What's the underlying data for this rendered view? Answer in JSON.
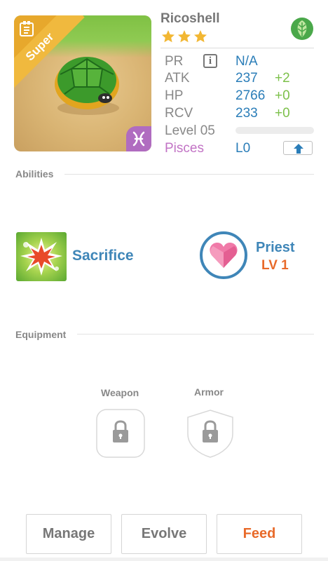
{
  "monster": {
    "name": "Ricoshell",
    "rarity_tag": "Super",
    "stars": 3,
    "element_icon": "leaf-icon",
    "sign_icon": "pisces-icon"
  },
  "stats": {
    "pr": {
      "label": "PR",
      "value": "N/A"
    },
    "atk": {
      "label": "ATK",
      "value": "237",
      "bonus": "+2"
    },
    "hp": {
      "label": "HP",
      "value": "2766",
      "bonus": "+0"
    },
    "rcv": {
      "label": "RCV",
      "value": "233",
      "bonus": "+0"
    },
    "level": {
      "label": "Level 05",
      "exp_fraction": 0.0
    },
    "sign": {
      "label": "Pisces",
      "value": "L0"
    }
  },
  "sections": {
    "abilities": "Abilities",
    "equipment": "Equipment"
  },
  "abilities": {
    "skill_name": "Sacrifice",
    "class_name": "Priest",
    "class_level": "LV 1"
  },
  "equipment": {
    "weapon_label": "Weapon",
    "armor_label": "Armor"
  },
  "actions": {
    "manage": "Manage",
    "evolve": "Evolve",
    "feed": "Feed"
  },
  "colors": {
    "accent_blue": "#3f86b8",
    "bonus_green": "#7cc04a",
    "feed_orange": "#e86a2a",
    "pisces_purple": "#c273c5",
    "super_gold": "#f0b93e"
  }
}
